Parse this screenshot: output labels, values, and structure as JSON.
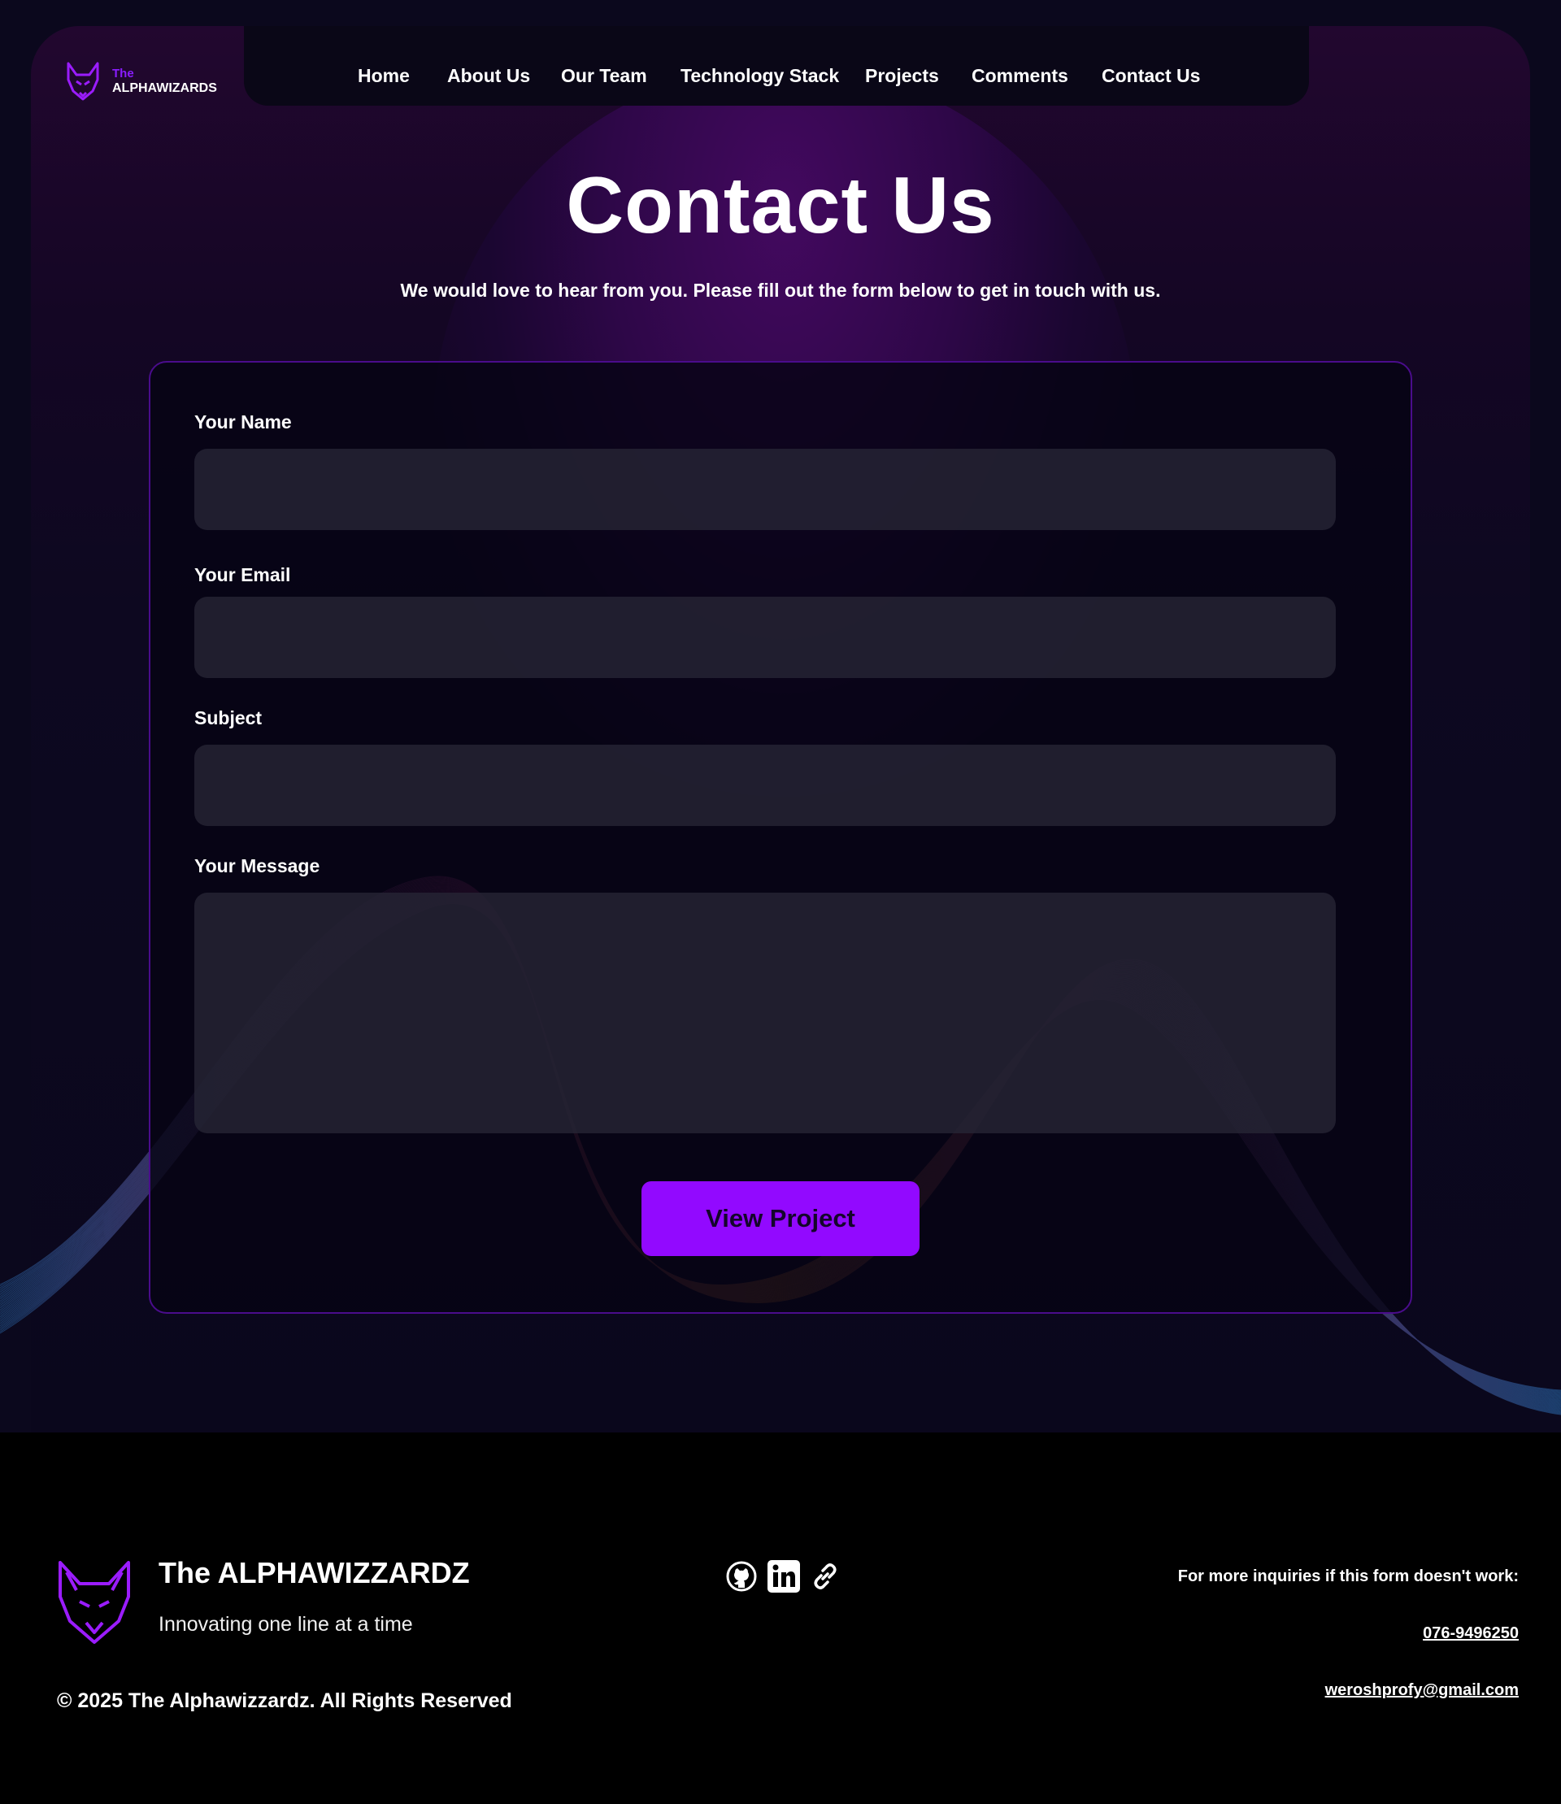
{
  "brand": {
    "logo_the": "The",
    "logo_name": "ALPHAWIZARDS",
    "accent": "#9209ff"
  },
  "nav": {
    "items": [
      {
        "label": "Home"
      },
      {
        "label": "About Us"
      },
      {
        "label": "Our Team"
      },
      {
        "label": "Technology Stack"
      },
      {
        "label": "Projects"
      },
      {
        "label": "Comments"
      },
      {
        "label": "Contact Us"
      }
    ]
  },
  "hero": {
    "title": "Contact Us",
    "subtitle": "We would love to hear from you. Please fill out the form below to get in touch with us."
  },
  "form": {
    "name_label": "Your Name",
    "name_value": "",
    "email_label": "Your Email",
    "email_value": "",
    "subject_label": "Subject",
    "subject_value": "",
    "message_label": "Your Message",
    "message_value": "",
    "submit_label": "View Project"
  },
  "footer": {
    "title": "The ALPHAWIZZARDZ",
    "tagline": "Innovating one line at a time",
    "copyright": "© 2025 The Alphawizzardz. All Rights Reserved",
    "social_icons": [
      "github-icon",
      "linkedin-icon",
      "link-icon"
    ],
    "inquiry_text": "For more inquiries if this form doesn't work:",
    "phone": "076-9496250",
    "email": "weroshprofy@gmail.com"
  }
}
